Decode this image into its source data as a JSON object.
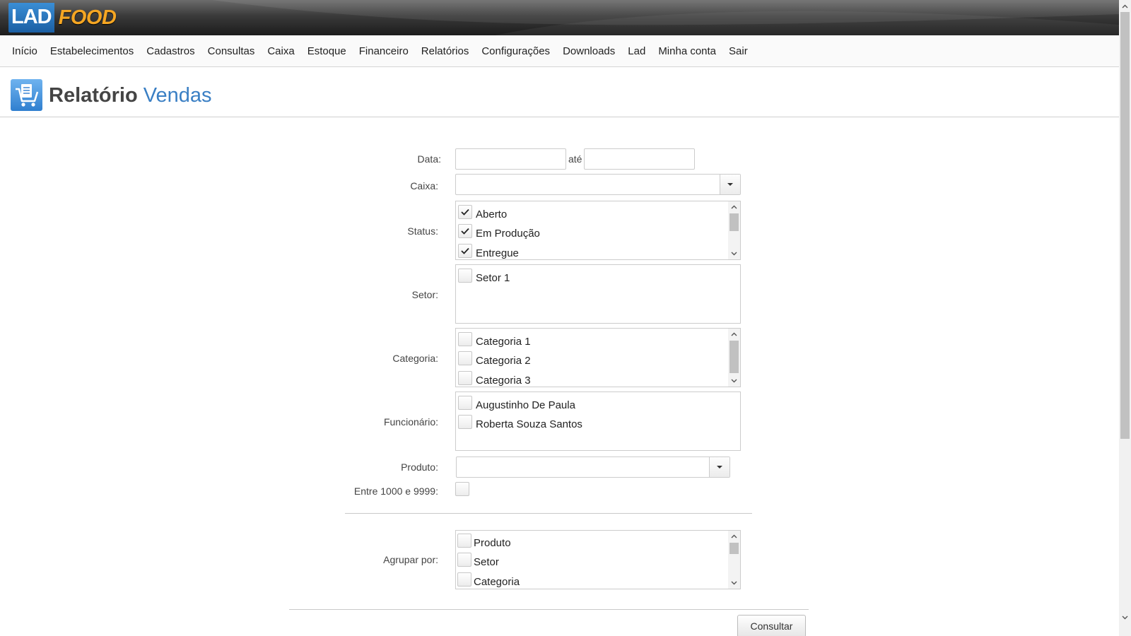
{
  "header": {
    "logo_part1": "LAD",
    "logo_part2": "FOOD",
    "brand_blue": "#2a6fb8",
    "brand_orange": "#f5a623"
  },
  "nav": {
    "items": [
      "Início",
      "Estabelecimentos",
      "Cadastros",
      "Consultas",
      "Caixa",
      "Estoque",
      "Financeiro",
      "Relatórios",
      "Configurações",
      "Downloads",
      "Lad",
      "Minha conta",
      "Sair"
    ]
  },
  "page": {
    "title_main": "Relatório",
    "title_accent": "Vendas",
    "title_icon": "cart-report-icon"
  },
  "form": {
    "data_label": "Data:",
    "date_from_value": "",
    "date_sep": "até",
    "date_to_value": "",
    "caixa_label": "Caixa:",
    "caixa_value": "",
    "status_label": "Status:",
    "status_options": [
      {
        "label": "Aberto",
        "checked": true
      },
      {
        "label": "Em Produção",
        "checked": true
      },
      {
        "label": "Entregue",
        "checked": true
      }
    ],
    "setor_label": "Setor:",
    "setor_options": [
      {
        "label": "Setor 1",
        "checked": false
      }
    ],
    "categoria_label": "Categoria:",
    "categoria_options": [
      {
        "label": "Categoria 1",
        "checked": false
      },
      {
        "label": "Categoria 2",
        "checked": false
      },
      {
        "label": "Categoria 3",
        "checked": false
      }
    ],
    "funcionario_label": "Funcionário:",
    "funcionario_options": [
      {
        "label": "Augustinho De Paula",
        "checked": false
      },
      {
        "label": "Roberta Souza Santos",
        "checked": false
      }
    ],
    "produto_label": "Produto:",
    "produto_value": "",
    "range_label": "Entre 1000 e 9999:",
    "range_checked": false,
    "agrupar_label": "Agrupar por:",
    "agrupar_options": [
      {
        "label": "Produto",
        "checked": false
      },
      {
        "label": "Setor",
        "checked": false
      },
      {
        "label": "Categoria",
        "checked": false
      }
    ],
    "submit_label": "Consultar"
  }
}
